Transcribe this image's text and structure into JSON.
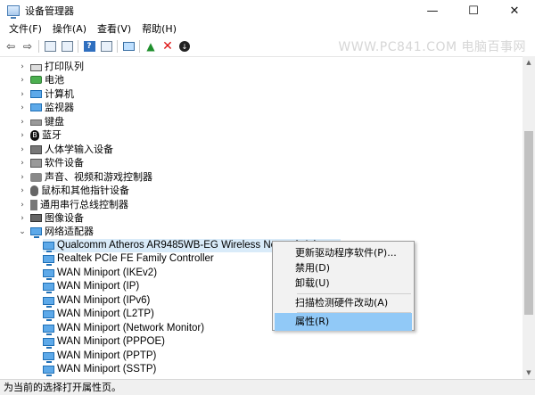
{
  "window": {
    "title": "设备管理器",
    "controls": {
      "minimize": "—",
      "maximize": "☐",
      "close": "✕"
    }
  },
  "menubar": [
    "文件(F)",
    "操作(A)",
    "查看(V)",
    "帮助(H)"
  ],
  "toolbar": {
    "icons": [
      "back-arrow-icon",
      "forward-arrow-icon",
      "properties-icon",
      "view-icon",
      "help-icon",
      "device-view-icon",
      "monitor-icon",
      "update-driver-icon",
      "uninstall-icon",
      "disable-icon"
    ]
  },
  "watermark": "WWW.PC841.COM 电脑百事网",
  "tree": {
    "categories": [
      {
        "label": "打印队列",
        "icon": "printer-icon"
      },
      {
        "label": "电池",
        "icon": "battery-icon"
      },
      {
        "label": "计算机",
        "icon": "computer-icon"
      },
      {
        "label": "监视器",
        "icon": "monitor-icon"
      },
      {
        "label": "键盘",
        "icon": "keyboard-icon"
      },
      {
        "label": "蓝牙",
        "icon": "bluetooth-icon"
      },
      {
        "label": "人体学输入设备",
        "icon": "hid-icon"
      },
      {
        "label": "软件设备",
        "icon": "software-device-icon"
      },
      {
        "label": "声音、视频和游戏控制器",
        "icon": "sound-icon"
      },
      {
        "label": "鼠标和其他指针设备",
        "icon": "mouse-icon"
      },
      {
        "label": "通用串行总线控制器",
        "icon": "usb-icon"
      },
      {
        "label": "图像设备",
        "icon": "camera-icon"
      },
      {
        "label": "网络适配器",
        "icon": "network-adapter-icon",
        "expanded": true
      }
    ],
    "network_adapters": [
      "Qualcomm Atheros AR9485WB-EG Wireless Network Adapter",
      "Realtek PCIe FE Family Controller",
      "WAN Miniport (IKEv2)",
      "WAN Miniport (IP)",
      "WAN Miniport (IPv6)",
      "WAN Miniport (L2TP)",
      "WAN Miniport (Network Monitor)",
      "WAN Miniport (PPPOE)",
      "WAN Miniport (PPTP)",
      "WAN Miniport (SSTP)"
    ],
    "selected_adapter": "Qualcomm Atheros AR9485WB-EG Wireless Network Adapter"
  },
  "context_menu": {
    "items": [
      "更新驱动程序软件(P)...",
      "禁用(D)",
      "卸载(U)",
      "扫描检测硬件改动(A)",
      "属性(R)"
    ],
    "highlighted": "属性(R)"
  },
  "statusbar": "为当前的选择打开属性页。",
  "colors": {
    "selection": "#d9ebf9",
    "menu_highlight": "#91c9f7",
    "menu_background": "#f2f2f2"
  }
}
